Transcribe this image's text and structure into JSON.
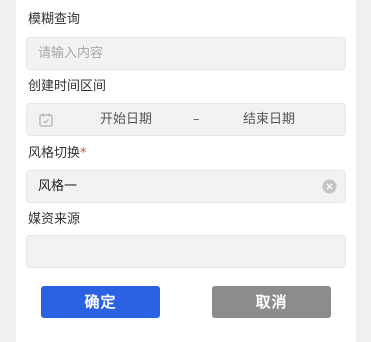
{
  "form": {
    "fuzzy_label": "模糊查询",
    "fuzzy_placeholder": "请输入内容",
    "date_label": "创建时间区间",
    "date_start": "开始日期",
    "date_separator": "–",
    "date_end": "结束日期",
    "style_label": "风格切换",
    "style_required_mark": "*",
    "style_value": "风格一",
    "source_label": "媒资来源",
    "source_value": ""
  },
  "buttons": {
    "confirm": "确定",
    "cancel": "取消"
  },
  "colors": {
    "primary": "#2a62e3",
    "cancel": "#8c8c8c",
    "required": "#e54545"
  },
  "icons": {
    "calendar": "calendar-icon",
    "clear": "clear-icon"
  }
}
